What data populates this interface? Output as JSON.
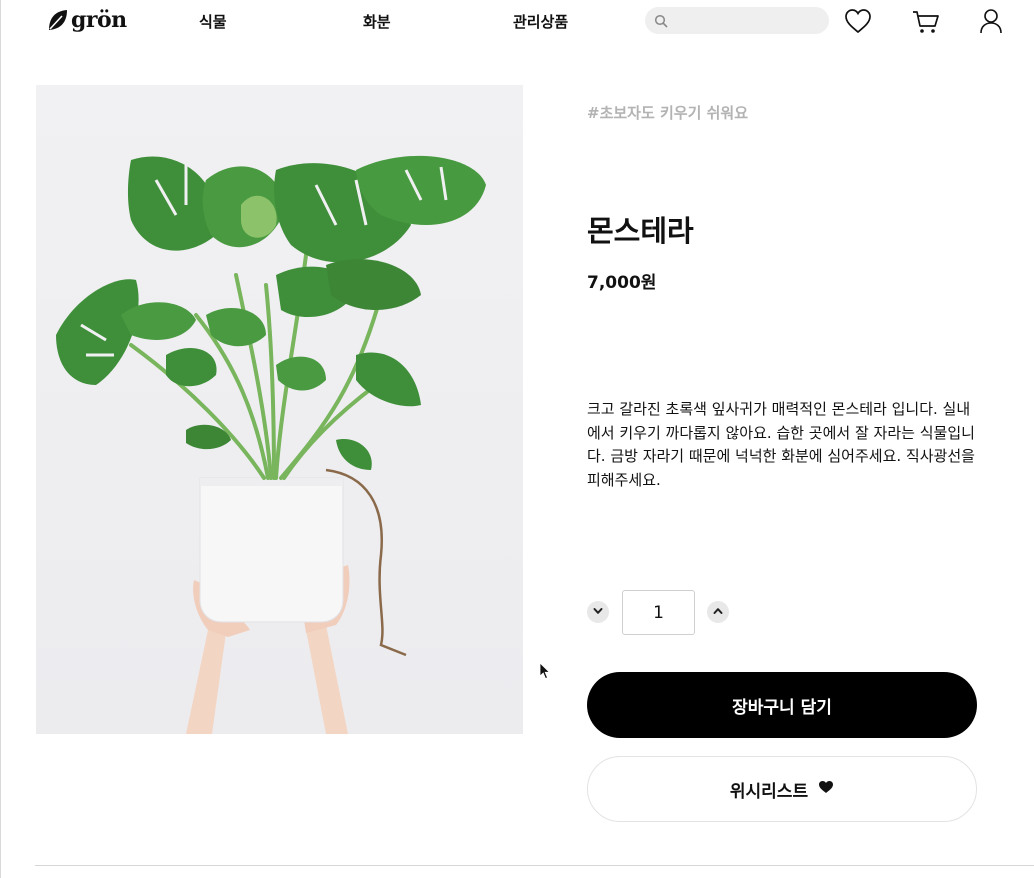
{
  "header": {
    "logo_text": "grön",
    "nav": [
      {
        "label": "식물"
      },
      {
        "label": "화분"
      },
      {
        "label": "관리상품"
      }
    ],
    "search": {
      "value": "",
      "placeholder": "",
      "icon": "search-icon"
    },
    "icons": [
      "heart-icon",
      "cart-icon",
      "user-icon"
    ]
  },
  "product": {
    "tag": "#초보자도 키우기 쉬워요",
    "name": "몬스테라",
    "price": "7,000원",
    "description": "크고 갈라진 초록색 잎사귀가 매력적인 몬스테라 입니다. 실내에서 키우기 까다롭지 않아요. 습한 곳에서 잘 자라는 식물입니다. 금방 자라기 때문에 넉넉한 화분에 심어주세요. 직사광선을 피해주세요.",
    "quantity": "1",
    "add_to_cart_label": "장바구니 담기",
    "wishlist_label": "위시리스트"
  },
  "colors": {
    "primary_button": "#000000",
    "tag_text": "#b3b3b3",
    "leaf_green": "#3f8f3a"
  }
}
